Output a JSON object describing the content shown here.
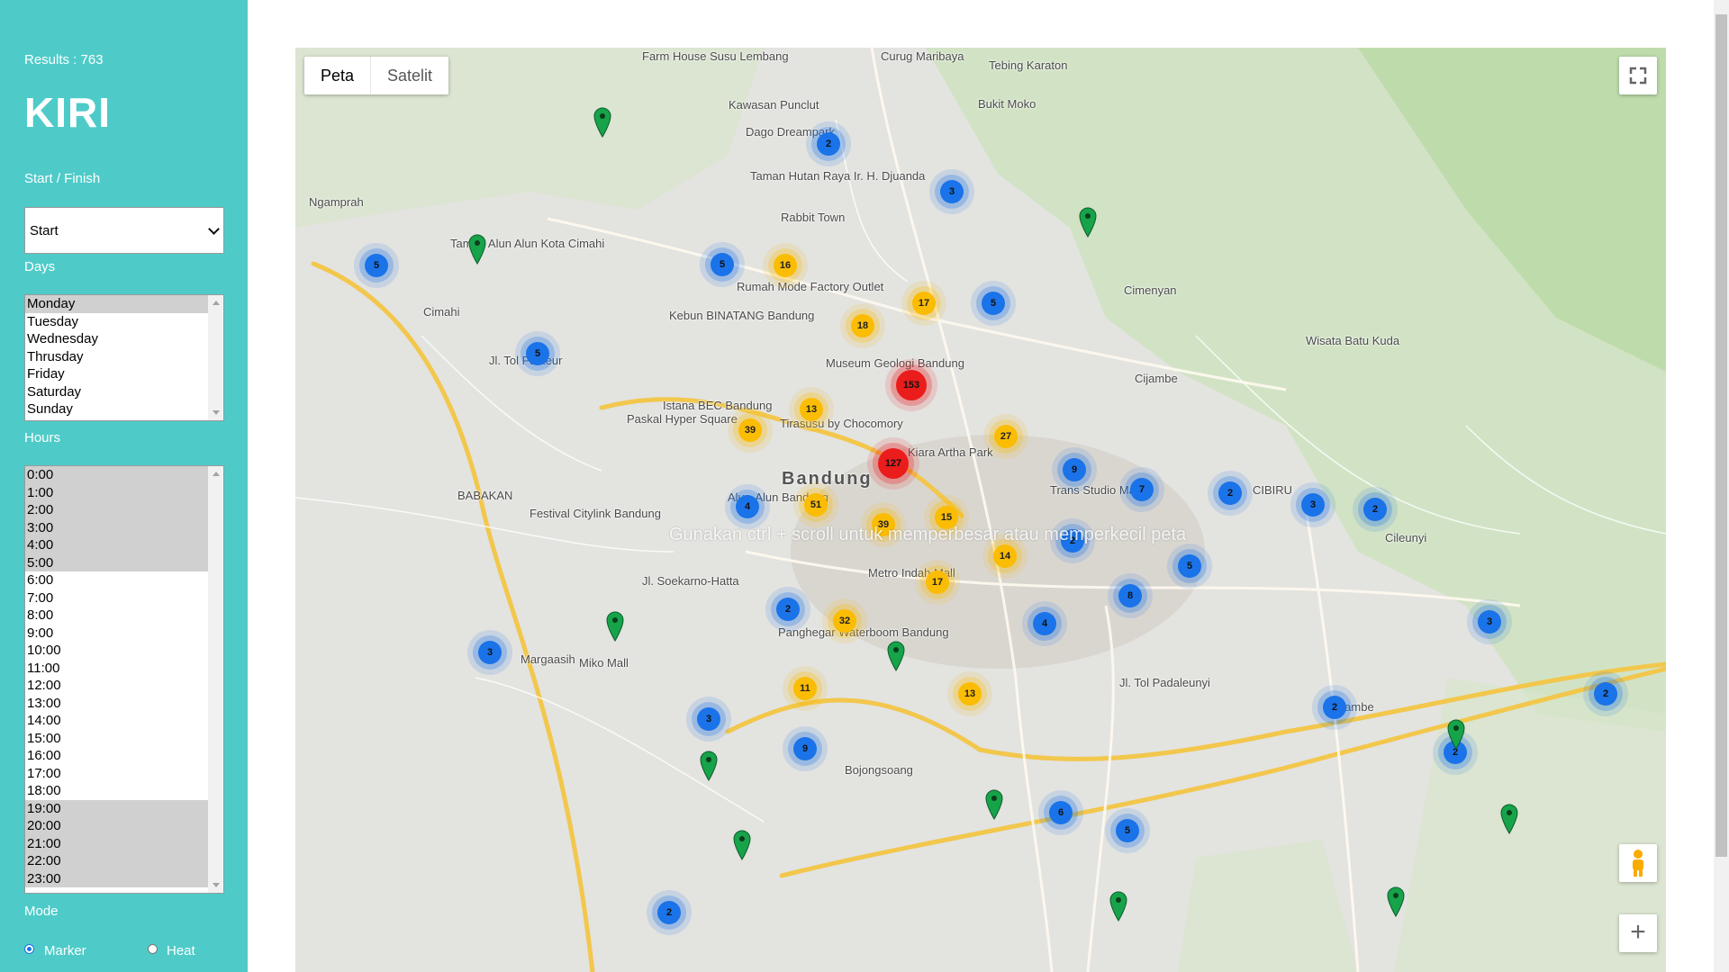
{
  "sidebar": {
    "results_label": "Results : 763",
    "title": "KIRI",
    "start_finish_label": "Start / Finish",
    "start_finish_value": "Start",
    "days_label": "Days",
    "days": [
      "Monday",
      "Tuesday",
      "Wednesday",
      "Thrusday",
      "Friday",
      "Saturday",
      "Sunday"
    ],
    "days_selected": [
      "Monday"
    ],
    "hours_label": "Hours",
    "hours": [
      "0:00",
      "1:00",
      "2:00",
      "3:00",
      "4:00",
      "5:00",
      "6:00",
      "7:00",
      "8:00",
      "9:00",
      "10:00",
      "11:00",
      "12:00",
      "13:00",
      "14:00",
      "15:00",
      "16:00",
      "17:00",
      "18:00",
      "19:00",
      "20:00",
      "21:00",
      "22:00",
      "23:00"
    ],
    "hours_selected": [
      "0:00",
      "1:00",
      "2:00",
      "3:00",
      "4:00",
      "5:00",
      "19:00",
      "20:00",
      "21:00",
      "22:00",
      "23:00"
    ],
    "mode_label": "Mode",
    "mode_options": [
      "Marker",
      "Heat"
    ],
    "mode_selected": "Marker"
  },
  "map": {
    "type_tabs": [
      "Peta",
      "Satelit"
    ],
    "active_tab": "Peta",
    "scroll_hint": "Gunakan ctrl + scroll untuk memperbesar atau memperkecil peta",
    "place_labels": [
      "Farm House Susu Lembang",
      "Curug Maribaya",
      "Tebing Karaton",
      "Kawasan Punclut",
      "Bukit Moko",
      "Dago Dreampark",
      "Taman Hutan Raya Ir. H. Djuanda",
      "Ngamprah",
      "Rabbit Town",
      "Taman Alun Alun Kota Cimahi",
      "Rumah Mode Factory Outlet",
      "Cimenyan",
      "Cimahi",
      "Kebun BINATANG Bandung",
      "Wisata Batu Kuda",
      "Museum Geologi Bandung",
      "Cijambe",
      "Istana BEC Bandung",
      "Paskal Hyper Square",
      "Tirasusu by Chocomory",
      "Kiara Artha Park",
      "Bandung",
      "Trans Studio Mall",
      "BABAKAN",
      "Alun-Alun Bandung",
      "CIBIRU",
      "Festival Citylink Bandung",
      "Cileunyi",
      "Metro Indah Mall",
      "Panghegar Waterboom Bandung",
      "Margaasih",
      "Miko Mall",
      "Jl. Tol Padaleunyi",
      "Jl. Tol Pasteur",
      "Jl. Soekarno-Hatta",
      "Cijambe",
      "Bojongsoang"
    ],
    "clusters": [
      {
        "count": "2",
        "color": "blue"
      },
      {
        "count": "3",
        "color": "blue"
      },
      {
        "count": "5",
        "color": "blue"
      },
      {
        "count": "5",
        "color": "blue"
      },
      {
        "count": "16",
        "color": "yellow"
      },
      {
        "count": "17",
        "color": "yellow"
      },
      {
        "count": "5",
        "color": "blue"
      },
      {
        "count": "18",
        "color": "yellow"
      },
      {
        "count": "5",
        "color": "blue"
      },
      {
        "count": "153",
        "color": "red"
      },
      {
        "count": "13",
        "color": "yellow"
      },
      {
        "count": "39",
        "color": "yellow"
      },
      {
        "count": "27",
        "color": "yellow"
      },
      {
        "count": "127",
        "color": "red"
      },
      {
        "count": "9",
        "color": "blue"
      },
      {
        "count": "7",
        "color": "blue"
      },
      {
        "count": "2",
        "color": "blue"
      },
      {
        "count": "3",
        "color": "blue"
      },
      {
        "count": "2",
        "color": "blue"
      },
      {
        "count": "4",
        "color": "blue"
      },
      {
        "count": "51",
        "color": "yellow"
      },
      {
        "count": "15",
        "color": "yellow"
      },
      {
        "count": "39",
        "color": "yellow"
      },
      {
        "count": "2",
        "color": "blue"
      },
      {
        "count": "14",
        "color": "yellow"
      },
      {
        "count": "5",
        "color": "blue"
      },
      {
        "count": "17",
        "color": "yellow"
      },
      {
        "count": "8",
        "color": "blue"
      },
      {
        "count": "2",
        "color": "blue"
      },
      {
        "count": "32",
        "color": "yellow"
      },
      {
        "count": "4",
        "color": "blue"
      },
      {
        "count": "3",
        "color": "blue"
      },
      {
        "count": "3",
        "color": "blue"
      },
      {
        "count": "11",
        "color": "yellow"
      },
      {
        "count": "13",
        "color": "yellow"
      },
      {
        "count": "3",
        "color": "blue"
      },
      {
        "count": "2",
        "color": "blue"
      },
      {
        "count": "2",
        "color": "blue"
      },
      {
        "count": "9",
        "color": "blue"
      },
      {
        "count": "2",
        "color": "blue"
      },
      {
        "count": "6",
        "color": "blue"
      },
      {
        "count": "5",
        "color": "blue"
      },
      {
        "count": "2",
        "color": "blue"
      }
    ],
    "colors": {
      "blue": "#1a73e8",
      "yellow": "#fbbc04",
      "red": "#ea1c1c",
      "pin": "#17a34a",
      "sidebar": "#4ecbc8"
    }
  }
}
